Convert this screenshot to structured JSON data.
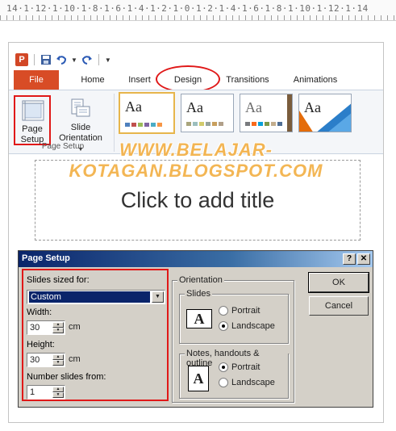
{
  "ruler": {
    "text": "14·1·12·1·10·1·8·1·6·1·4·1·2·1·0·1·2·1·4·1·6·1·8·1·10·1·12·1·14"
  },
  "app": {
    "logo_letter": "P"
  },
  "tabs": [
    {
      "label": "File"
    },
    {
      "label": "Home"
    },
    {
      "label": "Insert"
    },
    {
      "label": "Design"
    },
    {
      "label": "Transitions"
    },
    {
      "label": "Animations"
    }
  ],
  "ribbon": {
    "page_setup_line1": "Page",
    "page_setup_line2": "Setup",
    "slide_orientation_line1": "Slide",
    "slide_orientation_line2": "Orientation",
    "group_label": "Page Setup",
    "theme_sample": "Aa"
  },
  "slide": {
    "title_placeholder": "Click to add title"
  },
  "watermark": {
    "text": "WWW.BELAJAR-KOTAGAN.BLOGSPOT.COM"
  },
  "dialog": {
    "title": "Page Setup",
    "help_btn": "?",
    "close_btn": "✕",
    "slides_sized_for_label": "Slides sized for:",
    "slides_sized_for_value": "Custom",
    "width_label": "Width:",
    "width_value": "30",
    "width_unit": "cm",
    "height_label": "Height:",
    "height_value": "30",
    "height_unit": "cm",
    "number_from_label": "Number slides from:",
    "number_from_value": "1",
    "orientation_label": "Orientation",
    "slides_group": "Slides",
    "slides_portrait": "Portrait",
    "slides_landscape": "Landscape",
    "notes_group": "Notes, handouts & outline",
    "notes_portrait": "Portrait",
    "notes_landscape": "Landscape",
    "icon_letter": "A",
    "ok": "OK",
    "cancel": "Cancel"
  },
  "colors": {
    "file_tab": "#d84c26",
    "highlight_red": "#e01818",
    "dialog_bg": "#d4d0c8"
  }
}
